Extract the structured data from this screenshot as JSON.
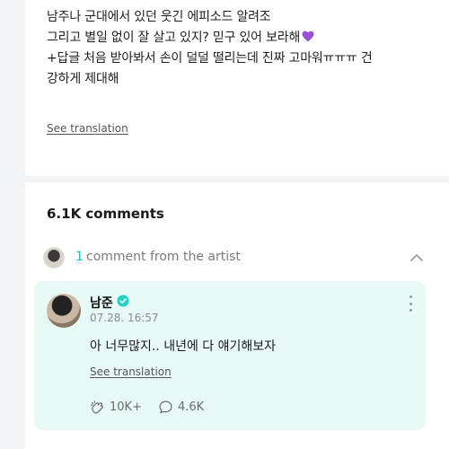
{
  "post": {
    "lines": [
      "남주나 군대에서 있던 웃긴 에피소드 알려조",
      "그리고 별일 없이 잘 살고 있지? 믿구 있어 보라해",
      "+답글 처음 받아봐서 손이 덜덜 떨리는데 진짜 고마워ㅠㅠㅠ 건",
      "강하게 제대해"
    ],
    "heart_color": "#9b4dd6",
    "see_translation": "See translation"
  },
  "comments": {
    "count_label": "6.1K comments",
    "artist_bar": {
      "count": "1",
      "label": "comment from the artist",
      "count_color": "#0fc4c4",
      "toggle_icon": "chevron-up-icon"
    },
    "artist_comment": {
      "author": "남준",
      "verified_icon": "verified-check-icon",
      "verified_color": "#1fd2c6",
      "date": "07.28. 16:57",
      "text": "아 너무많지.. 내년에 다 얘기해보자",
      "see_translation": "See translation",
      "likes": "10K+",
      "replies": "4.6K",
      "background": "#e8faf6"
    }
  }
}
